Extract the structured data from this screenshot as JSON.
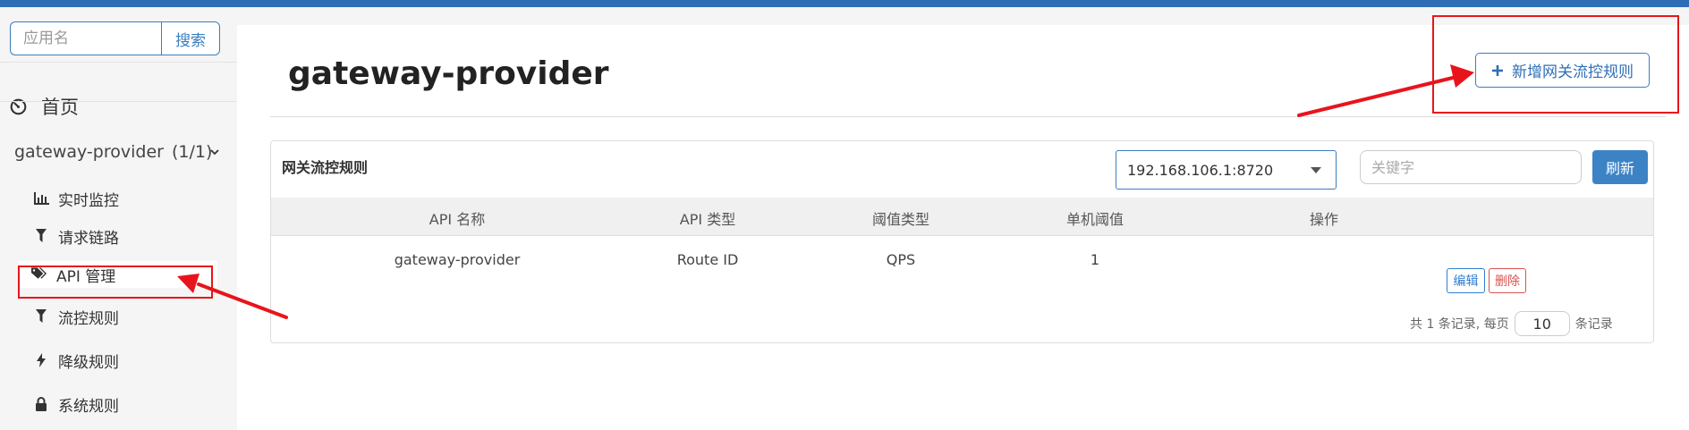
{
  "sidebar": {
    "search": {
      "placeholder": "应用名",
      "button_label": "搜索"
    },
    "home_label": "首页",
    "app": {
      "name": "gateway-provider",
      "count": "(1/1)"
    },
    "menu_items": [
      {
        "icon": "bar-chart-icon",
        "label": "实时监控"
      },
      {
        "icon": "filter-icon",
        "label": "请求链路"
      },
      {
        "icon": "tags-icon",
        "label": "API 管理"
      },
      {
        "icon": "filter-icon",
        "label": "流控规则"
      },
      {
        "icon": "bolt-icon",
        "label": "降级规则"
      },
      {
        "icon": "lock-icon",
        "label": "系统规则"
      }
    ]
  },
  "main": {
    "title": "gateway-provider",
    "add_button_label": "新增网关流控规则",
    "panel": {
      "title": "网关流控规则",
      "machine_select": "192.168.106.1:8720",
      "keyword_placeholder": "关键字",
      "refresh_label": "刷新",
      "columns": [
        "API 名称",
        "API 类型",
        "阈值类型",
        "单机阈值",
        "操作"
      ],
      "rows": [
        {
          "api_name": "gateway-provider",
          "api_type": "Route ID",
          "threshold_type": "QPS",
          "threshold": "1",
          "edit_label": "编辑",
          "delete_label": "删除"
        }
      ],
      "pagination": {
        "prefix": "共 1 条记录, 每页",
        "page_size": "10",
        "suffix": "条记录"
      }
    }
  },
  "colors": {
    "accent": "#2f6eb5",
    "annotation": "#e8141c",
    "danger": "#d9534f"
  }
}
